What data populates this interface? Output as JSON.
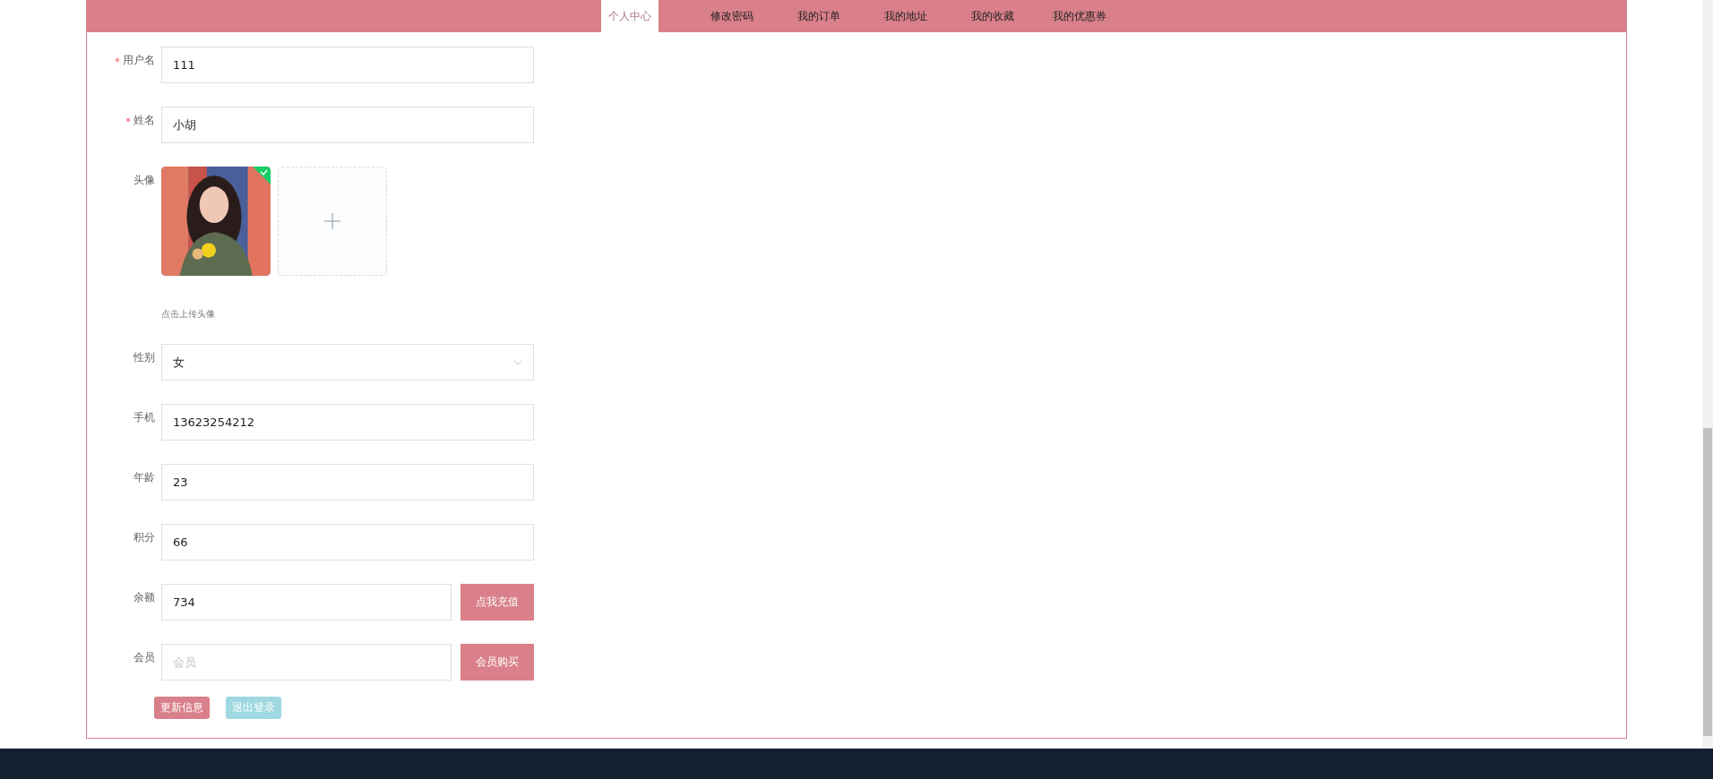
{
  "nav": {
    "tabs": [
      {
        "label": "个人中心",
        "selected": true
      },
      {
        "label": "修改密码",
        "selected": false
      },
      {
        "label": "我的订单",
        "selected": false
      },
      {
        "label": "我的地址",
        "selected": false
      },
      {
        "label": "我的收藏",
        "selected": false
      },
      {
        "label": "我的优惠券",
        "selected": false
      }
    ]
  },
  "form": {
    "fields": [
      {
        "kind": "text",
        "label": "用户名",
        "required": true,
        "value": "111"
      },
      {
        "kind": "text",
        "label": "姓名",
        "required": true,
        "value": "小胡"
      },
      {
        "kind": "upload",
        "label": "头像",
        "required": false,
        "hint": "点击上传头像",
        "uploaded": true
      },
      {
        "kind": "select",
        "label": "性别",
        "required": false,
        "value": "女"
      },
      {
        "kind": "text",
        "label": "手机",
        "required": false,
        "value": "13623254212"
      },
      {
        "kind": "text",
        "label": "年龄",
        "required": false,
        "value": "23"
      },
      {
        "kind": "text",
        "label": "积分",
        "required": false,
        "value": "66"
      },
      {
        "kind": "action",
        "label": "余额",
        "required": false,
        "value": "734",
        "button": "点我充值"
      },
      {
        "kind": "action",
        "label": "会员",
        "required": false,
        "placeholder": "会员",
        "button": "会员购买"
      }
    ],
    "buttons": [
      {
        "label": "更新信息",
        "kind": "primary"
      },
      {
        "label": "退出登录",
        "kind": "secondary"
      }
    ]
  }
}
